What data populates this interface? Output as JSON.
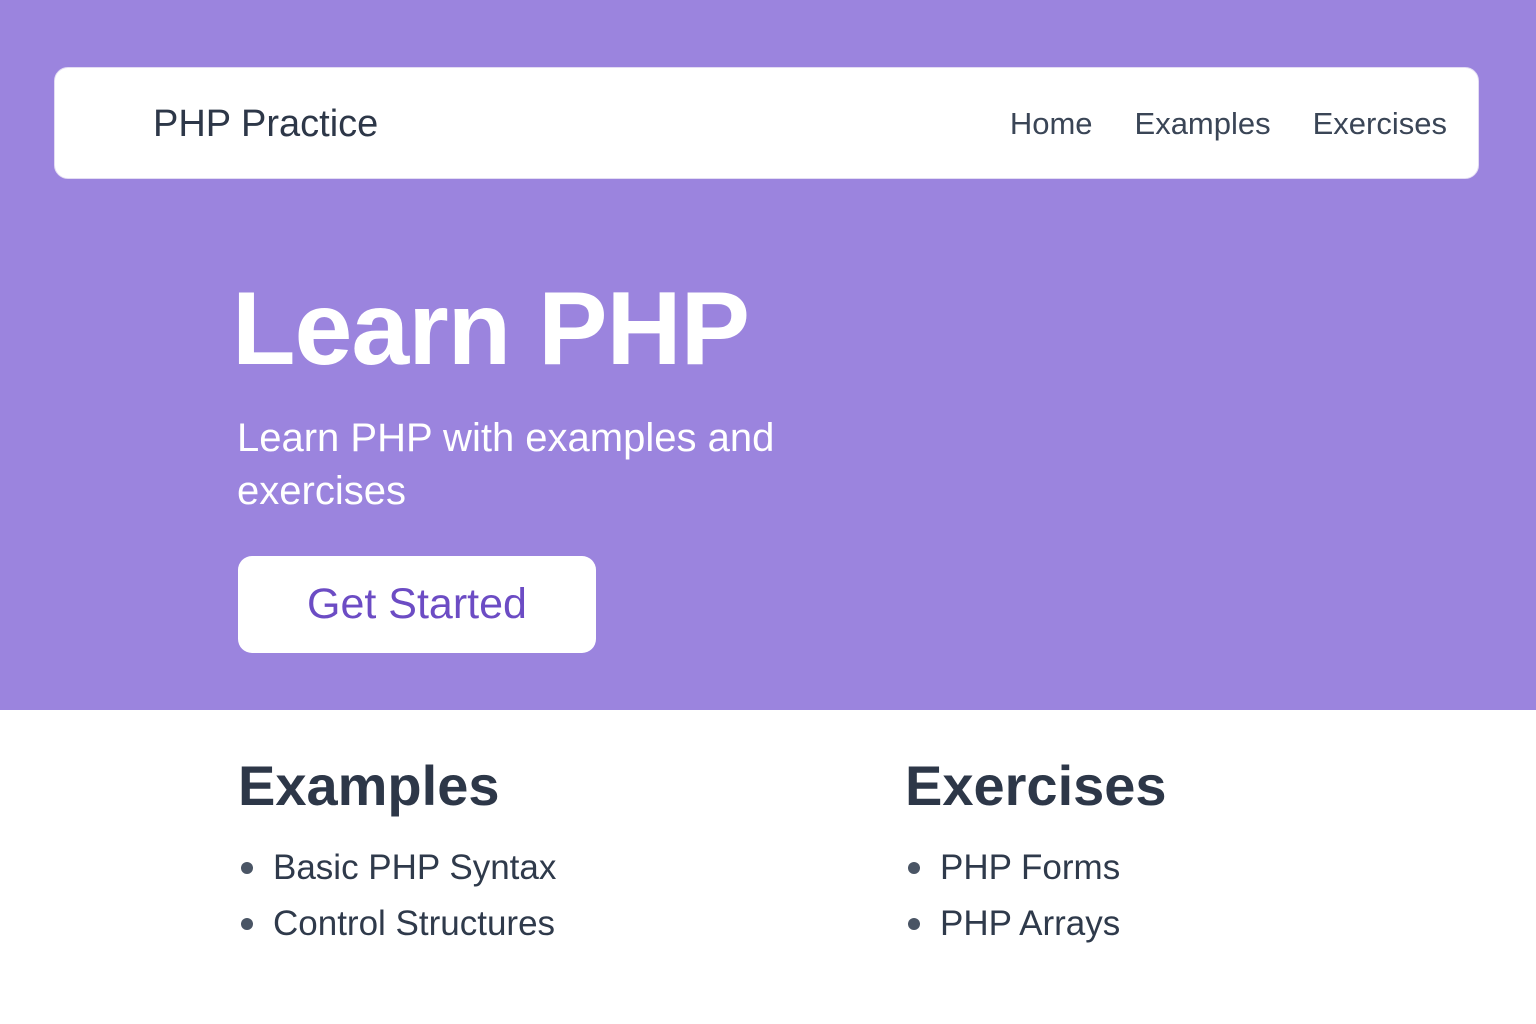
{
  "header": {
    "brand": "PHP Practice",
    "nav": [
      "Home",
      "Examples",
      "Exercises"
    ]
  },
  "hero": {
    "title": "Learn PHP",
    "subtitle": "Learn PHP with examples and exercises",
    "cta_label": "Get Started",
    "background_color": "#9b84de",
    "accent_color": "#6c4cc4"
  },
  "examples": {
    "title": "Examples",
    "items": [
      "Basic PHP Syntax",
      "Control Structures"
    ]
  },
  "exercises": {
    "title": "Exercises",
    "items": [
      "PHP Forms",
      "PHP Arrays"
    ]
  }
}
